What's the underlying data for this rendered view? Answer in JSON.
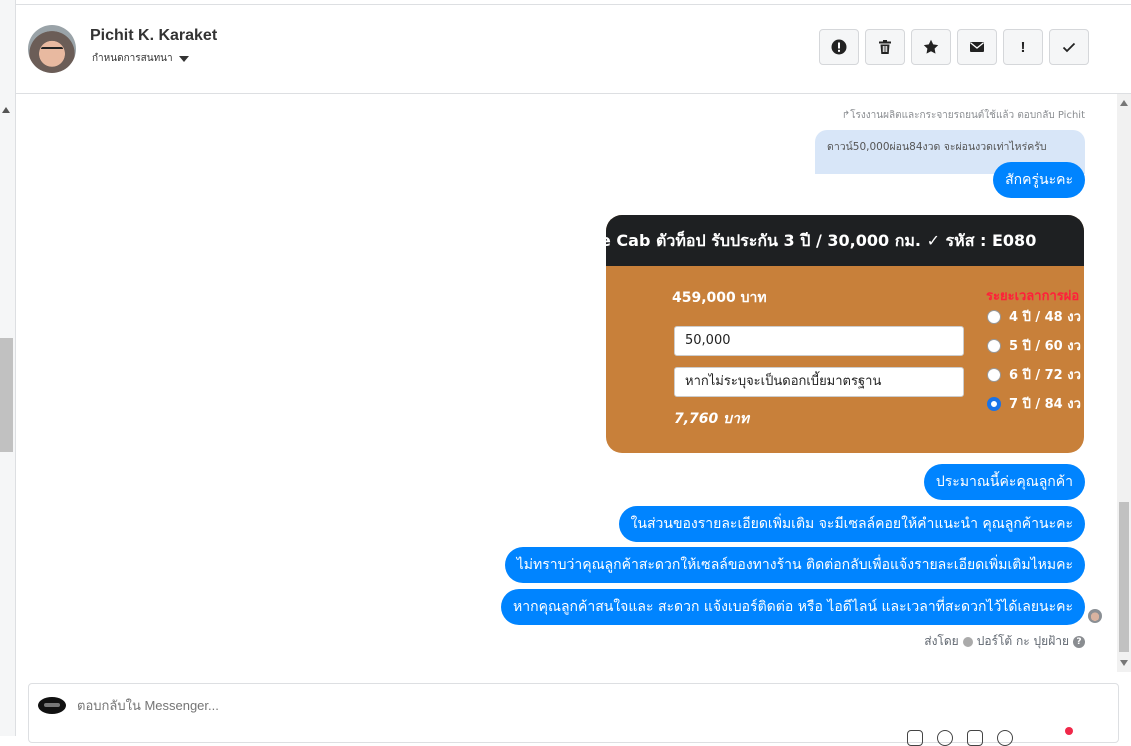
{
  "header": {
    "name": "Pichit K. Karaket",
    "assign_label": "กำหนดการสนทนา",
    "actions": [
      {
        "icon": "alert-circle-icon",
        "label": ""
      },
      {
        "icon": "trash-icon",
        "label": ""
      },
      {
        "icon": "star-icon",
        "label": ""
      },
      {
        "icon": "envelope-icon",
        "label": ""
      },
      {
        "icon": "exclamation-icon",
        "label": "!"
      },
      {
        "icon": "check-icon",
        "label": ""
      }
    ]
  },
  "conversation": {
    "reply_note": "↱โรงงานผลิตและกระจายรถยนต์ใช้แล้ว ตอบกลับ Pichit",
    "quoted_text": "ดาวน์50,000ผ่อน84งวด จะผ่อนงวดเท่าไหร่ครับ",
    "messages": [
      "สักครู่นะคะ",
      "ประมาณนี้ค่ะคุณลูกค้า",
      "ในส่วนของรายละเอียดเพิ่มเติม จะมีเซลล์คอยให้คำแนะนำ คุณลูกค้านะคะ",
      "ไม่ทราบว่าคุณลูกค้าสะดวกให้เซลล์ของทางร้าน ติดต่อกลับเพื่อแจ้งรายละเอียดเพิ่มเติมไหมคะ",
      "หากคุณลูกค้าสนใจและ สะดวก แจ้งเบอร์ติดต่อ หรือ ไอดีไลน์ และเวลาที่สะดวกไว้ได้เลยนะคะ"
    ],
    "sent_by_label": "ส่งโดย",
    "sent_by_name": "ปอร์โต้ กะ ปุยฝ้าย"
  },
  "calculator_card": {
    "title": "e Cab ตัวท็อป รับประกัน 3 ปี / 30,000 กม. ✓ รหัส : E080",
    "price": "459,000 บาท",
    "down_payment": "50,000",
    "interest_placeholder": "หากไม่ระบุจะเป็นดอกเบี้ยมาตรฐาน",
    "monthly": "7,760 บาท",
    "period_title": "ระยะเวลาการผ่อ",
    "options": [
      {
        "label": "4 ปี / 48 งว",
        "selected": false
      },
      {
        "label": "5 ปี / 60 งว",
        "selected": false
      },
      {
        "label": "6 ปี / 72 งว",
        "selected": false
      },
      {
        "label": "7 ปี / 84 งว",
        "selected": true
      }
    ]
  },
  "composer": {
    "placeholder": "ตอบกลับใน Messenger..."
  },
  "colors": {
    "bubble": "#0084ff",
    "quoted": "#d8e6f8",
    "card_bg": "#c8803a",
    "card_header": "#1e2022",
    "period_title": "#ff1f3a"
  }
}
